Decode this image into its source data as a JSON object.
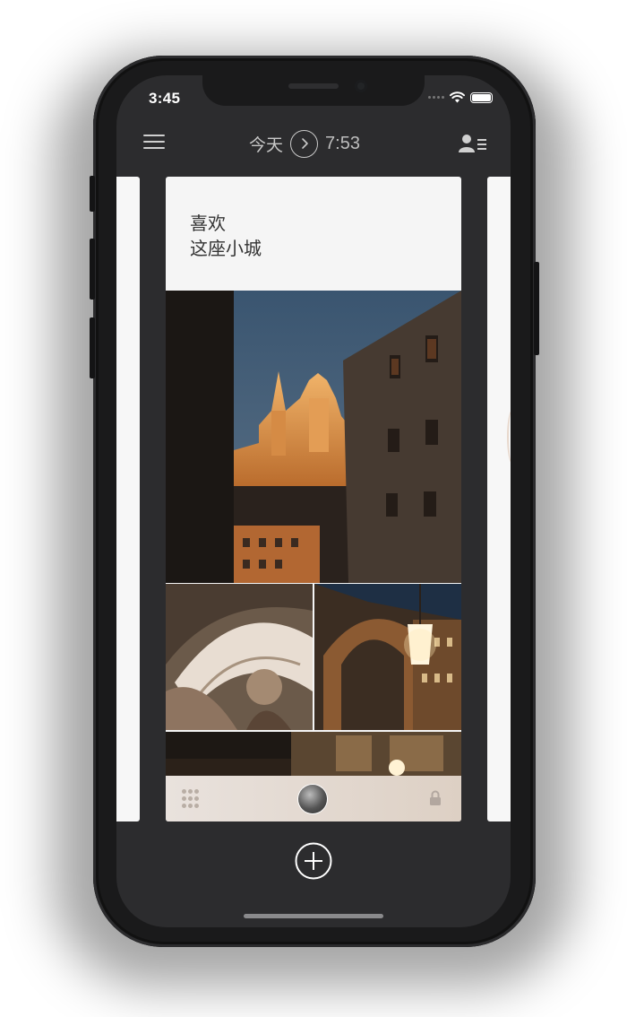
{
  "status_bar": {
    "time": "3:45"
  },
  "header": {
    "title_text": "今天",
    "time": "7:53"
  },
  "card": {
    "text_line1": "喜欢",
    "text_line2": "这座小城"
  },
  "photos": [
    {
      "name": "cathedral-night-street"
    },
    {
      "name": "vaulted-ceiling"
    },
    {
      "name": "lantern-arcade"
    },
    {
      "name": "plaza-facade-strip"
    }
  ],
  "icons": {
    "menu": "menu-icon",
    "clock": "chevron-circle-icon",
    "profile": "profile-list-icon",
    "grid": "dots-grid-icon",
    "lock": "lock-icon",
    "add": "plus-circle-icon"
  },
  "colors": {
    "screen_bg": "#2c2c2e",
    "card_bg": "#f5f5f5",
    "header_text": "#c9c9c9",
    "footer_gradient_start": "#e9e2dd",
    "footer_gradient_end": "#ddd0c4"
  }
}
